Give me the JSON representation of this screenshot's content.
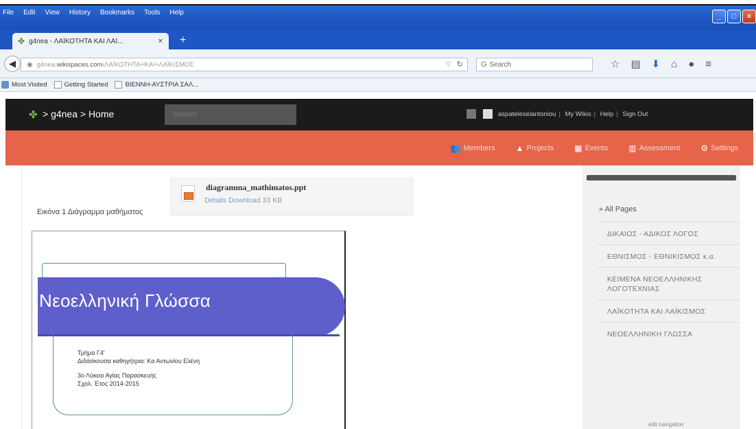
{
  "browser": {
    "menu": [
      "File",
      "Edit",
      "View",
      "History",
      "Bookmarks",
      "Tools",
      "Help"
    ],
    "tab_title": "g4nea - ΛΑΪΚΟΤΗΤΑ ΚΑΙ ΛΑΪ...",
    "url_prefix": "g4nea.",
    "url_domain": "wikispaces.com",
    "url_path": "/ΛΑΪΚΟΤΗΤΑ+ΚΑΙ+ΛΑΪΚΙΣΜΟΣ",
    "search_placeholder": "Search",
    "bookmarks": [
      "Most Visited",
      "Getting Started",
      "ΒΙΕΝΝΗ-ΑΥΣΤΡΙΑ ΣΑΛ..."
    ]
  },
  "site": {
    "breadcrumb": "> g4nea > Home",
    "search_placeholder": "Search",
    "user_links": [
      "aspateleselantoniou",
      "My Wikis",
      "Help",
      "Sign Out"
    ],
    "nav": [
      {
        "label": "Members",
        "icon": "members-icon"
      },
      {
        "label": "Projects",
        "icon": "projects-icon"
      },
      {
        "label": "Events",
        "icon": "calendar-icon"
      },
      {
        "label": "Assessment",
        "icon": "chart-icon"
      },
      {
        "label": "Settings",
        "icon": "gear-icon"
      }
    ]
  },
  "attachment": {
    "filename": "diagramma_mathimatos.ppt",
    "details": "Details",
    "download": "Download",
    "size": "33 KB"
  },
  "caption": "Εικόνα 1 Διάγραμμα μαθήματος",
  "slide": {
    "title": "Νεοελληνική Γλώσσα",
    "lines": [
      "Τμήμα Γ4'",
      "Διδάσκουσα καθηγήτρια: Κα Αντωνίου Ελένη",
      "3ο Λύκειο Αγίας Παρασκευής",
      "Σχολ. Έτος 2014-2015"
    ]
  },
  "sidebar": {
    "all_pages": "» All Pages",
    "items": [
      "ΔΙΚΑΙΟΣ - ΑΔΙΚΟΣ ΛΟΓΟΣ",
      "ΕΘΝΙΣΜΟΣ - ΕΘΝΙΚΙΣΜΟΣ κ.α.",
      "ΚΕΙΜΕΝΑ ΝΕΟΕΛΛΗΝΙΚΗΣ ΛΟΓΟΤΕΧΝΙΑΣ",
      "ΛΑΪΚΟΤΗΤΑ ΚΑΙ ΛΑΪΚΙΣΜΟΣ",
      "ΝΕΟΕΛΛΗΝΙΚΗ ΓΛΩΣΣΑ"
    ],
    "edit_navigation": "edit navigation"
  }
}
